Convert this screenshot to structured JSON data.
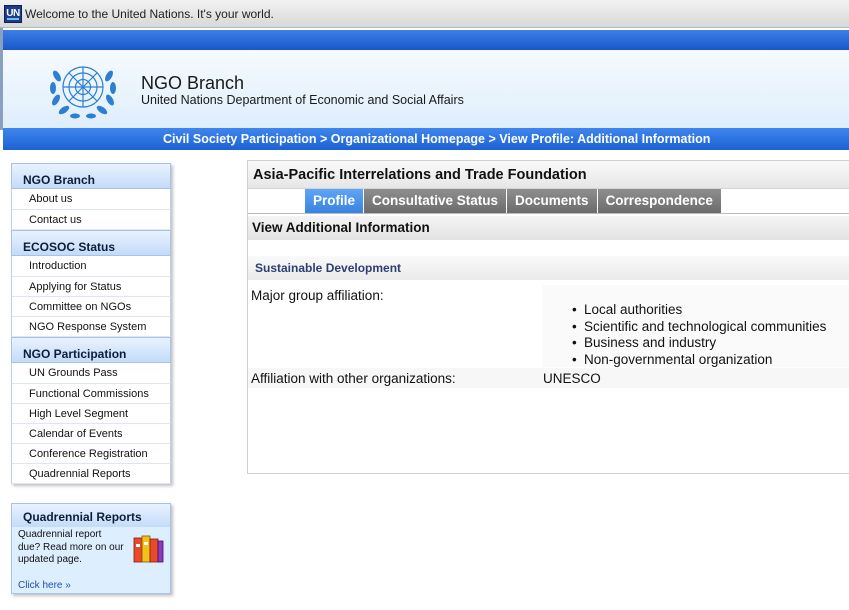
{
  "topbar": {
    "logo": "UN",
    "welcome": "Welcome to the United Nations. It's your world."
  },
  "header": {
    "title": "NGO Branch",
    "subtitle": "United Nations Department of Economic and Social Affairs",
    "emblem_icon": "un-emblem-icon"
  },
  "breadcrumb": {
    "items": [
      "Civil Society Participation",
      "Organizational Homepage",
      "View Profile: Additional Information"
    ],
    "separator": ">"
  },
  "sidebar": {
    "sections": [
      {
        "title": "NGO Branch",
        "items": [
          "About us",
          "Contact us"
        ]
      },
      {
        "title": "ECOSOC Status",
        "items": [
          "Introduction",
          "Applying for Status",
          "Committee on NGOs",
          "NGO Response System"
        ]
      },
      {
        "title": "NGO Participation",
        "items": [
          "UN Grounds Pass",
          "Functional Commissions",
          "High Level Segment",
          "Calendar of Events",
          "Conference Registration",
          "Quadrennial Reports"
        ]
      }
    ]
  },
  "quadrennial_box": {
    "title": "Quadrennial Reports",
    "text": "Quadrennial report due? Read more on our updated page.",
    "link": "Click here »",
    "icon": "report-books-icon"
  },
  "content": {
    "org_name": "Asia-Pacific Interrelations and Trade Foundation",
    "tabs": [
      {
        "label": "Profile",
        "active": true
      },
      {
        "label": "Consultative Status",
        "active": false
      },
      {
        "label": "Documents",
        "active": false
      },
      {
        "label": "Correspondence",
        "active": false
      }
    ],
    "view_heading": "View Additional Information",
    "section_heading": "Sustainable Development",
    "major_group_label": "Major group affiliation:",
    "major_group_values": [
      "Local authorities",
      "Scientific and technological communities",
      "Business and industry",
      "Non-governmental organization"
    ],
    "other_orgs_label": "Affiliation with other organizations:",
    "other_orgs_value": "UNESCO"
  },
  "colors": {
    "band_blue": "#1d62d4",
    "tab_active": "#3882e3",
    "tab_inactive": "#6c6c6c",
    "section_heading": "#2c3f75"
  }
}
